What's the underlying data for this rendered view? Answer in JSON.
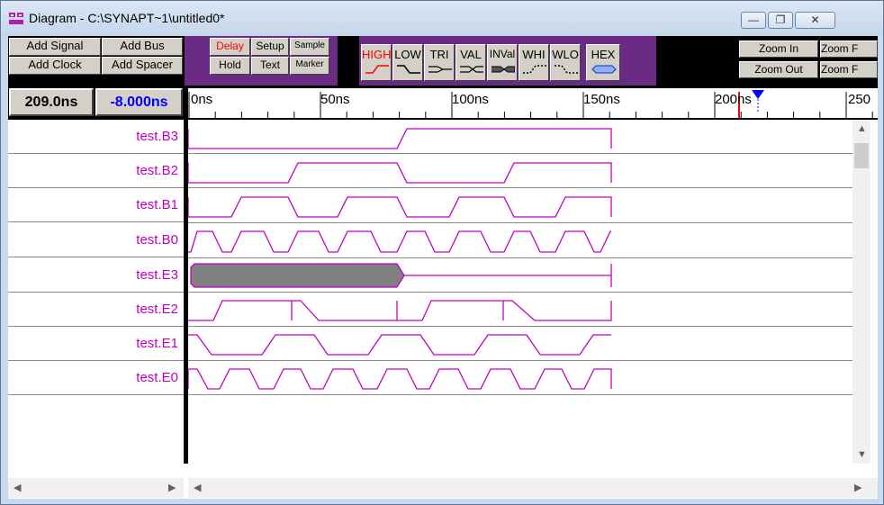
{
  "window": {
    "title": "Diagram - C:\\SYNAPT~1\\untitled0*",
    "min": "—",
    "max": "❐",
    "close": "✕"
  },
  "toolbar": {
    "add_signal": "Add Signal",
    "add_bus": "Add Bus",
    "add_clock": "Add Clock",
    "add_spacer": "Add Spacer",
    "delay": "Delay",
    "setup": "Setup",
    "sample": "Sample",
    "hold": "Hold",
    "text": "Text",
    "marker": "Marker",
    "high": "HIGH",
    "low": "LOW",
    "tri": "TRI",
    "val": "VAL",
    "inval": "INVal",
    "whi": "WHI",
    "wlo": "WLO",
    "hex": "HEX",
    "zoom_in": "Zoom In",
    "zoom_out": "Zoom Out",
    "zoom_full_top": "Zoom F",
    "zoom_full_bottom": "Zoom F",
    "accent_red": "#ff0000",
    "accent_purple": "#6a2b85"
  },
  "timebar": {
    "cursor_time": "209.0ns",
    "delta_time": "-8.000ns",
    "ticks": [
      "0ns",
      "50ns",
      "100ns",
      "150ns",
      "200ns",
      "250"
    ]
  },
  "signals": [
    {
      "name": "test.B3"
    },
    {
      "name": "test.B2"
    },
    {
      "name": "test.B1"
    },
    {
      "name": "test.B0"
    },
    {
      "name": "test.E3"
    },
    {
      "name": "test.E2"
    },
    {
      "name": "test.E1"
    },
    {
      "name": "test.E0"
    }
  ],
  "colors": {
    "wave": "#c000c0",
    "bus_fill": "#808080",
    "marker": "#ff0000",
    "cursor": "#0000ff"
  }
}
